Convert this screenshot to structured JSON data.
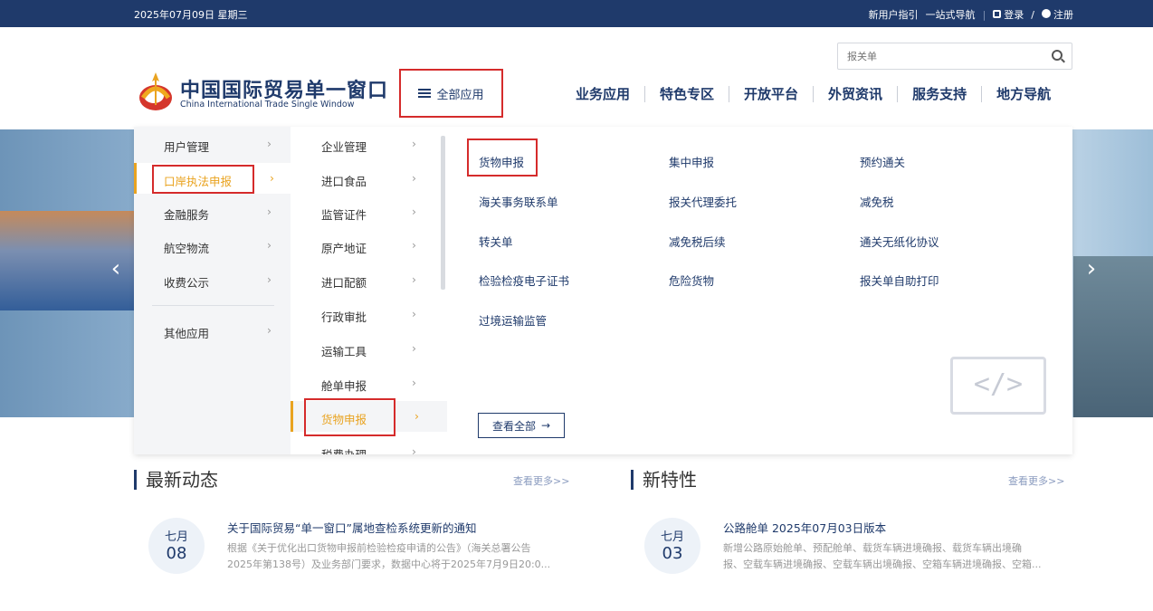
{
  "topbar": {
    "date": "2025年07月09日 星期三",
    "newbie": "新用户指引",
    "onestop": "一站式导航",
    "login": "登录",
    "slash": "/",
    "register": "注册"
  },
  "search": {
    "placeholder": "报关单"
  },
  "brand": {
    "title": "中国国际贸易单一窗口",
    "subtitle": "China International Trade Single Window"
  },
  "all_apps": "全部应用",
  "mainnav": [
    "业务应用",
    "特色专区",
    "开放平台",
    "外贸资讯",
    "服务支持",
    "地方导航"
  ],
  "menu": {
    "col1": [
      "用户管理",
      "口岸执法申报",
      "金融服务",
      "航空物流",
      "收费公示",
      "其他应用"
    ],
    "col2": [
      "企业管理",
      "进口食品",
      "监管证件",
      "原产地证",
      "进口配额",
      "行政审批",
      "运输工具",
      "舱单申报",
      "货物申报",
      "税费办理"
    ],
    "col3": [
      [
        "货物申报",
        "集中申报",
        "预约通关"
      ],
      [
        "海关事务联系单",
        "报关代理委托",
        "减免税"
      ],
      [
        "转关单",
        "减免税后续",
        "通关无纸化协议"
      ],
      [
        "检验检疫电子证书",
        "危险货物",
        "报关单自助打印"
      ],
      [
        "过境运输监管"
      ]
    ],
    "view_all": "查看全部",
    "chevron": "›"
  },
  "news": {
    "heading": "最新动态",
    "more": "查看更多>>",
    "item": {
      "month": "七月",
      "day": "08",
      "title": "关于国际贸易“单一窗口”属地查检系统更新的通知",
      "line1": "根据《关于优化出口货物申报前检验检疫申请的公告》（海关总署公告",
      "line2": "2025年第138号）及业务部门要求，数据中心将于2025年7月9日20:0..."
    }
  },
  "features": {
    "heading": "新特性",
    "more": "查看更多>>",
    "item": {
      "month": "七月",
      "day": "03",
      "title": "公路舱单 2025年07月03日版本",
      "line1": "新增公路原始舱单、预配舱单、载货车辆进境确报、载货车辆出境确",
      "line2": "报、空载车辆进境确报、空载车辆出境确报、空箱车辆进境确报、空箱..."
    }
  }
}
